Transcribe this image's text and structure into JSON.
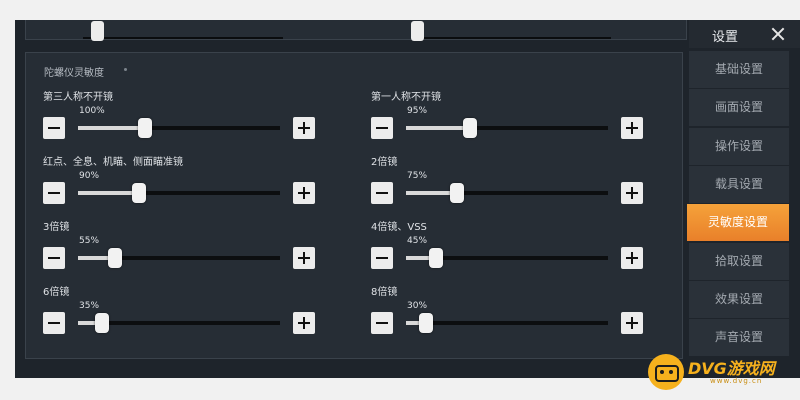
{
  "sidebar": {
    "title": "设置",
    "items": [
      {
        "label": "基础设置",
        "active": false
      },
      {
        "label": "画面设置",
        "active": false
      },
      {
        "label": "操作设置",
        "active": false
      },
      {
        "label": "载具设置",
        "active": false
      },
      {
        "label": "灵敏度设置",
        "active": true
      },
      {
        "label": "拾取设置",
        "active": false
      },
      {
        "label": "效果设置",
        "active": false
      },
      {
        "label": "声音设置",
        "active": false
      }
    ]
  },
  "section": {
    "title": "陀螺仪灵敏度"
  },
  "sliders": [
    {
      "label": "第三人称不开镜",
      "value_text": "100%",
      "value": 100
    },
    {
      "label": "第一人称不开镜",
      "value_text": "95%",
      "value": 95
    },
    {
      "label": "红点、全息、机瞄、侧面瞄准镜",
      "value_text": "90%",
      "value": 90
    },
    {
      "label": "2倍镜",
      "value_text": "75%",
      "value": 75
    },
    {
      "label": "3倍镜",
      "value_text": "55%",
      "value": 55
    },
    {
      "label": "4倍镜、VSS",
      "value_text": "45%",
      "value": 45
    },
    {
      "label": "6倍镜",
      "value_text": "35%",
      "value": 35
    },
    {
      "label": "8倍镜",
      "value_text": "30%",
      "value": 30
    }
  ],
  "slider_range": {
    "min": 0,
    "max": 300
  },
  "watermark": {
    "text": "DVG游戏网",
    "url": "www.dvg.cn"
  },
  "colors": {
    "accent": "#ef8f30",
    "panel": "#262d35",
    "background": "#1e242b"
  },
  "icons": {
    "close": "close-icon",
    "minus": "minus-icon",
    "plus": "plus-icon",
    "watermark": "gamepad-icon"
  }
}
